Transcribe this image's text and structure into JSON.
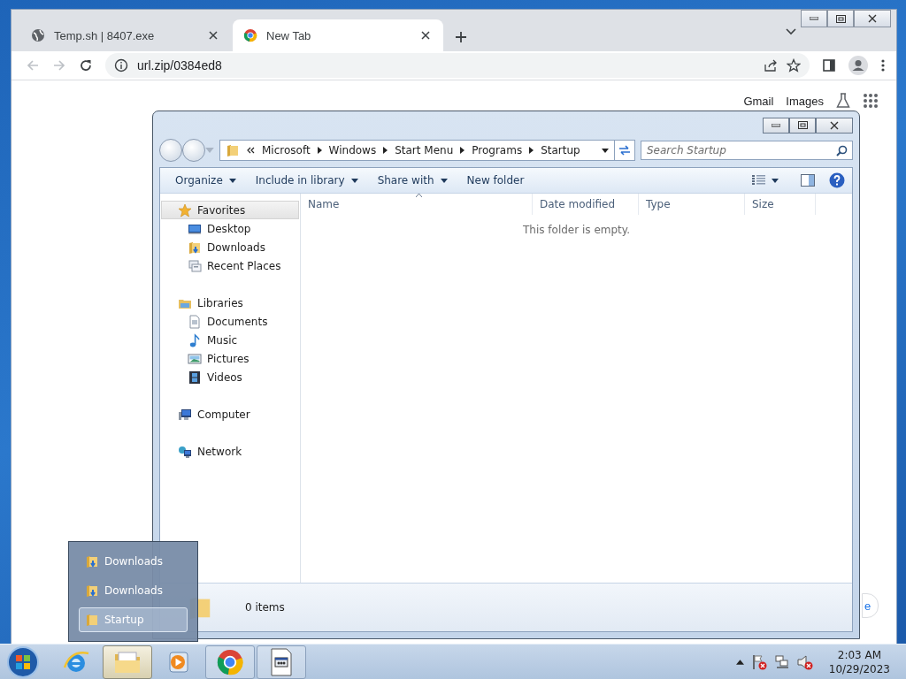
{
  "chrome": {
    "tabs": [
      {
        "title": "Temp.sh | 8407.exe",
        "kind": "globe",
        "selected": false
      },
      {
        "title": "New Tab",
        "kind": "chrome",
        "selected": true
      }
    ],
    "url": "url.zip/0384ed8",
    "links": [
      "Gmail",
      "Images"
    ],
    "partial_button": "e"
  },
  "explorer": {
    "breadcrumb": [
      "Microsoft",
      "Windows",
      "Start Menu",
      "Programs",
      "Startup"
    ],
    "search": {
      "placeholder": "Search Startup"
    },
    "commands": [
      {
        "label": "Organize",
        "dropdown": true
      },
      {
        "label": "Include in library",
        "dropdown": true
      },
      {
        "label": "Share with",
        "dropdown": true
      },
      {
        "label": "New folder",
        "dropdown": false
      }
    ],
    "columns": [
      "Name",
      "Date modified",
      "Type",
      "Size"
    ],
    "empty_message": "This folder is empty.",
    "nav": [
      {
        "label": "Favorites",
        "kind": "star",
        "selected": true,
        "children": [
          {
            "label": "Desktop",
            "kind": "desktop",
            "selected": false
          },
          {
            "label": "Downloads",
            "kind": "downloads",
            "selected": false
          },
          {
            "label": "Recent Places",
            "kind": "recent",
            "selected": false
          }
        ]
      },
      {
        "label": "Libraries",
        "kind": "library",
        "selected": false,
        "children": [
          {
            "label": "Documents",
            "kind": "document",
            "selected": false
          },
          {
            "label": "Music",
            "kind": "music",
            "selected": false
          },
          {
            "label": "Pictures",
            "kind": "picture",
            "selected": false
          },
          {
            "label": "Videos",
            "kind": "film",
            "selected": false
          }
        ]
      },
      {
        "label": "Computer",
        "kind": "computer",
        "selected": false
      },
      {
        "label": "Network",
        "kind": "network",
        "selected": false
      }
    ],
    "status": "0 items"
  },
  "jump_list": [
    {
      "label": "Downloads",
      "kind": "downloads",
      "selected": false
    },
    {
      "label": "Downloads",
      "kind": "downloads",
      "selected": false
    },
    {
      "label": "Startup",
      "kind": "folder",
      "selected": true
    }
  ],
  "taskbar": {
    "apps": [
      {
        "kind": "ie",
        "active": false
      },
      {
        "kind": "explorer",
        "active": true
      },
      {
        "kind": "media",
        "active": false
      },
      {
        "kind": "chrome",
        "active": false
      },
      {
        "kind": "app",
        "active": false
      }
    ],
    "time": "2:03 AM",
    "date": "10/29/2023"
  }
}
